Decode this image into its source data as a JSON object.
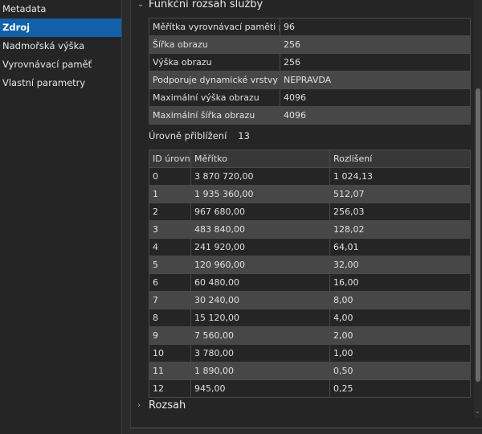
{
  "sidebar": {
    "items": [
      {
        "label": "Metadata"
      },
      {
        "label": "Zdroj",
        "active": true
      },
      {
        "label": "Nadmořská výška"
      },
      {
        "label": "Vyrovnávací paměť"
      },
      {
        "label": "Vlastní parametry"
      }
    ]
  },
  "section": {
    "title": "Funkční rozsah služby",
    "expanded": true
  },
  "properties": [
    {
      "name": "Měřítka vyrovnávací paměti při",
      "value": "96"
    },
    {
      "name": "Šířka obrazu",
      "value": "256"
    },
    {
      "name": "Výška obrazu",
      "value": "256"
    },
    {
      "name": "Podporuje dynamické vrstvy",
      "value": "NEPRAVDA"
    },
    {
      "name": "Maximální výška obrazu",
      "value": "4096"
    },
    {
      "name": "Maximální šířka obrazu",
      "value": "4096"
    }
  ],
  "zoom_levels": {
    "label": "Úrovně přiblížení",
    "count": "13"
  },
  "levels_table": {
    "headers": [
      "ID úrovn",
      "Měřítko",
      "Rozlišení"
    ],
    "rows": [
      [
        "0",
        "3 870 720,00",
        "1 024,13"
      ],
      [
        "1",
        "1 935 360,00",
        "512,07"
      ],
      [
        "2",
        "967 680,00",
        "256,03"
      ],
      [
        "3",
        "483 840,00",
        "128,02"
      ],
      [
        "4",
        "241 920,00",
        "64,01"
      ],
      [
        "5",
        "120 960,00",
        "32,00"
      ],
      [
        "6",
        "60 480,00",
        "16,00"
      ],
      [
        "7",
        "30 240,00",
        "8,00"
      ],
      [
        "8",
        "15 120,00",
        "4,00"
      ],
      [
        "9",
        "7 560,00",
        "2,00"
      ],
      [
        "10",
        "3 780,00",
        "1,00"
      ],
      [
        "11",
        "1 890,00",
        "0,50"
      ],
      [
        "12",
        "945,00",
        "0,25"
      ]
    ]
  },
  "section2": {
    "title": "Rozsah",
    "expanded": false
  }
}
